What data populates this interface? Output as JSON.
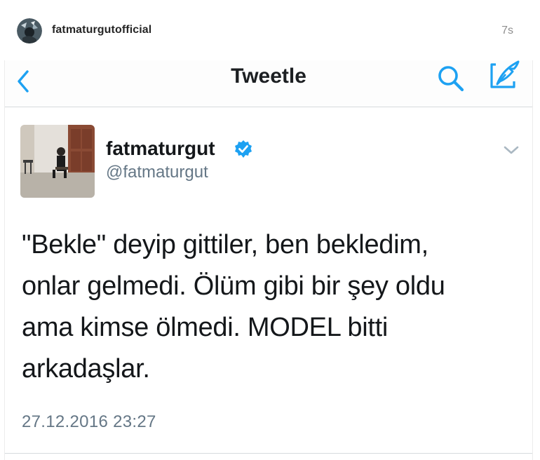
{
  "instagram": {
    "username": "fatmaturgutofficial",
    "time": "7s"
  },
  "twitter_nav": {
    "title": "Tweetle",
    "back_icon": "chevron-left-icon",
    "search_icon": "search-icon",
    "compose_icon": "compose-icon"
  },
  "tweet": {
    "name": "fatmaturgut",
    "handle": "@fatmaturgut",
    "text_lines": [
      "\"Bekle\" deyip gittiler, ben bekledim,",
      "onlar gelmedi. Ölüm gibi bir şey oldu",
      "ama kimse ölmedi. MODEL bitti",
      "arkadaşlar."
    ],
    "date": "27.12.2016 23:27",
    "verified_icon": "verified-badge-icon",
    "menu_icon": "chevron-down-icon"
  },
  "colors": {
    "accent": "#1da1f2",
    "muted": "#657786",
    "text": "#14171a"
  }
}
